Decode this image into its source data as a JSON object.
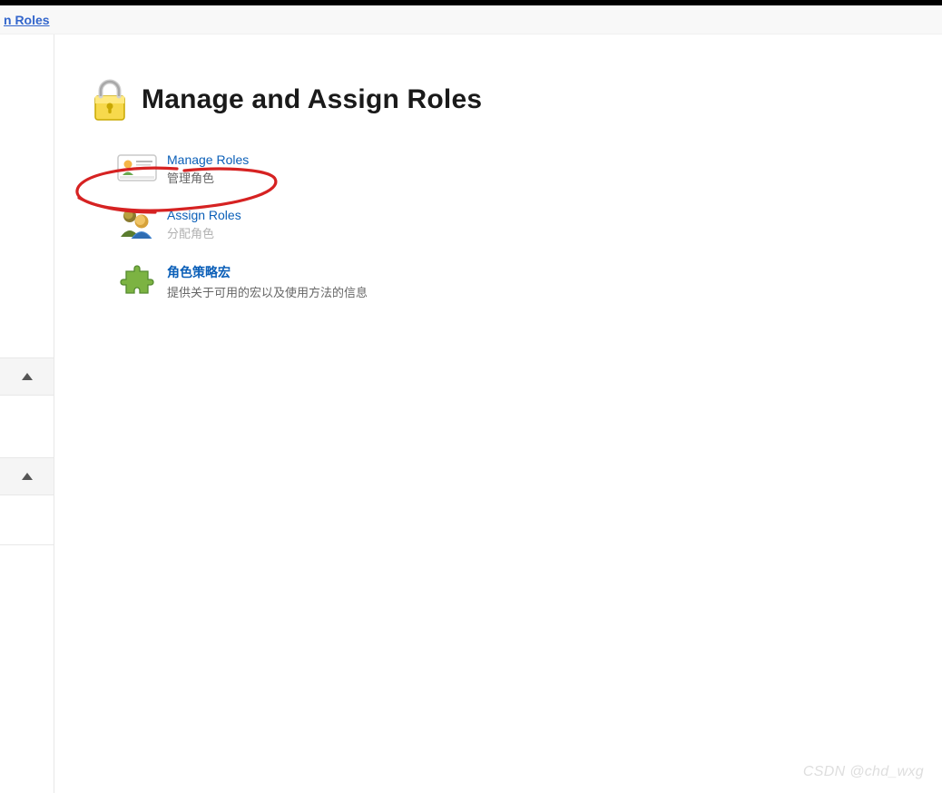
{
  "breadcrumb": {
    "current": "n Roles"
  },
  "header": {
    "title": "Manage and Assign Roles"
  },
  "items": [
    {
      "title": "Manage Roles",
      "desc": "管理角色"
    },
    {
      "title": "Assign Roles",
      "desc": "分配角色"
    },
    {
      "title": "角色策略宏",
      "desc": "提供关于可用的宏以及使用方法的信息"
    }
  ],
  "watermark": "CSDN @chd_wxg"
}
